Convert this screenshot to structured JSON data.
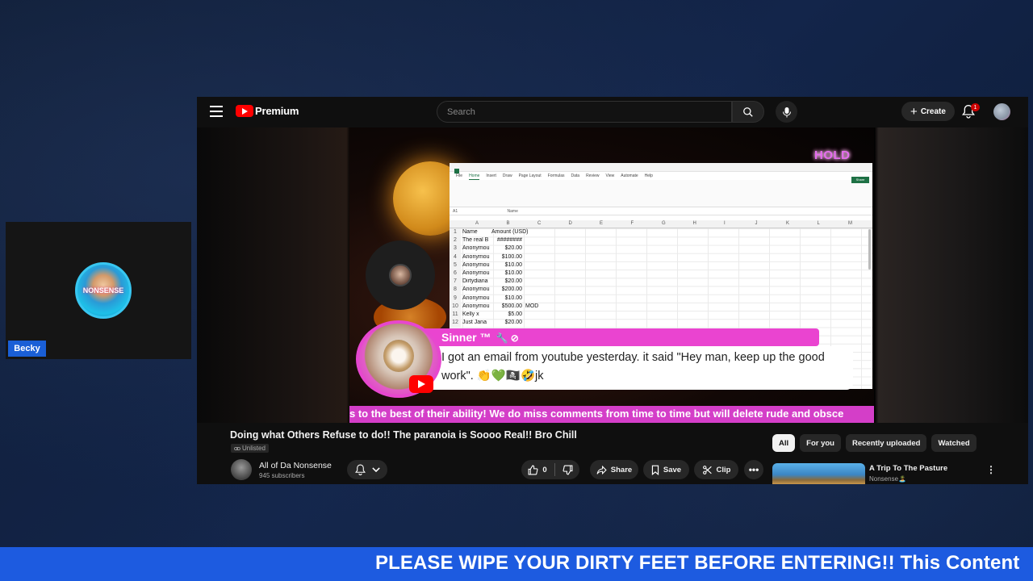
{
  "webcam": {
    "name_tag": "Becky",
    "avatar_text": "NONSENSE"
  },
  "header": {
    "brand": "Premium",
    "search_placeholder": "Search",
    "create_label": "Create",
    "notification_count": "1"
  },
  "player": {
    "overlay_hold": "HOLD",
    "spreadsheet": {
      "menu": [
        "File",
        "Home",
        "Insert",
        "Draw",
        "Page Layout",
        "Formulas",
        "Data",
        "Review",
        "View",
        "Automate",
        "Help"
      ],
      "share_label": "Share",
      "cell_ref": "A1",
      "formula": "Name",
      "columns": [
        "A",
        "B",
        "C",
        "D",
        "E",
        "F",
        "G",
        "H",
        "I",
        "J",
        "K",
        "L",
        "M"
      ],
      "rows": [
        {
          "n": "1",
          "name": "Name",
          "amount": "Amount (USD)",
          "extra": ""
        },
        {
          "n": "2",
          "name": "The real B",
          "amount": "########",
          "extra": ""
        },
        {
          "n": "3",
          "name": "Anonymou",
          "amount": "$20.00",
          "extra": ""
        },
        {
          "n": "4",
          "name": "Anonymou",
          "amount": "$100.00",
          "extra": ""
        },
        {
          "n": "5",
          "name": "Anonymou",
          "amount": "$10.00",
          "extra": ""
        },
        {
          "n": "6",
          "name": "Anonymou",
          "amount": "$10.00",
          "extra": ""
        },
        {
          "n": "7",
          "name": "Dirtydiana",
          "amount": "$20.00",
          "extra": ""
        },
        {
          "n": "8",
          "name": "Anonymou",
          "amount": "$200.00",
          "extra": ""
        },
        {
          "n": "9",
          "name": "Anonymou",
          "amount": "$10.00",
          "extra": ""
        },
        {
          "n": "10",
          "name": "Anonymou",
          "amount": "$500.00",
          "extra": "MOD"
        },
        {
          "n": "11",
          "name": "Kelly x",
          "amount": "$5.00",
          "extra": ""
        },
        {
          "n": "12",
          "name": "Just Jana",
          "amount": "$20.00",
          "extra": ""
        }
      ]
    },
    "chat": {
      "author": "Sinner ™",
      "author_icons": "🔧 ⊘",
      "message": "I got an email from youtube yesterday. it said \"Hey man, keep up the good work\". 👏💚🏴‍☠️🤣jk"
    },
    "ticker": "s to the best of their ability! We do miss comments from time to time but will delete rude and obsce"
  },
  "video": {
    "title": "Doing what Others Refuse to do!! The paranoia is Soooo Real!! Bro Chill",
    "visibility": "Unlisted",
    "channel_name": "All of Da Nonsense",
    "subscribers": "945 subscribers",
    "like_count": "0",
    "share_label": "Share",
    "save_label": "Save",
    "clip_label": "Clip",
    "more_label": "•••"
  },
  "recommendations": {
    "chips": [
      {
        "label": "All",
        "active": true
      },
      {
        "label": "For you",
        "active": false
      },
      {
        "label": "Recently uploaded",
        "active": false
      },
      {
        "label": "Watched",
        "active": false
      }
    ],
    "items": [
      {
        "title": "A Trip To The Pasture",
        "channel": "Nonsense🏝️"
      }
    ]
  },
  "banner": {
    "text": "PLEASE WIPE YOUR DIRTY FEET BEFORE ENTERING!! This Content"
  },
  "colors": {
    "accent_pink": "#ea44d0",
    "banner_blue": "#1d5be0",
    "yt_red": "#ff0000"
  }
}
